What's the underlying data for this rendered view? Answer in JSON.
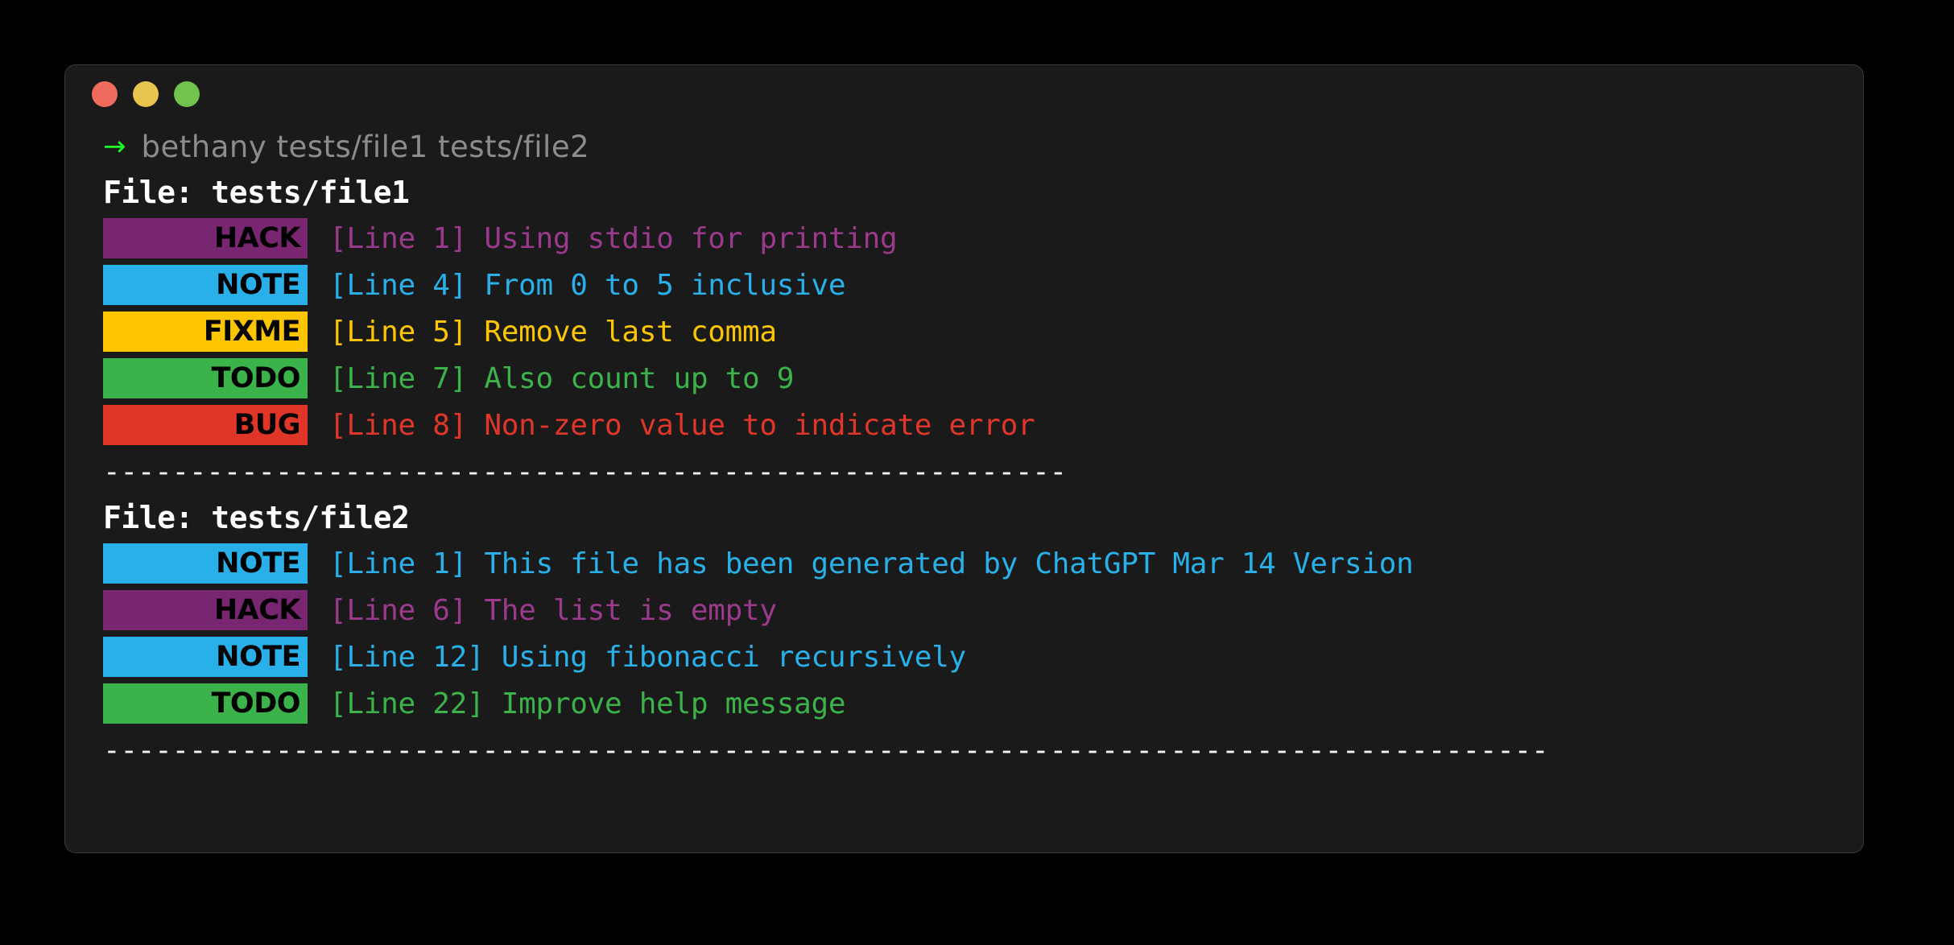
{
  "window": {
    "traffic_lights": [
      {
        "name": "close-button",
        "color": "#ef6b5e"
      },
      {
        "name": "minimize-button",
        "color": "#e7c44e"
      },
      {
        "name": "maximize-button",
        "color": "#72c250"
      }
    ]
  },
  "terminal": {
    "prompt_symbol": "→",
    "prompt_symbol_color": "#19f924",
    "command": "bethany tests/file1 tests/file2",
    "command_color": "#8c8c8c"
  },
  "tag_styles": {
    "HACK": {
      "badge_bg": "#78266f",
      "text_color": "#9b3a8c"
    },
    "NOTE": {
      "badge_bg": "#29b0e8",
      "text_color": "#29b0e8"
    },
    "FIXME": {
      "badge_bg": "#fdc500",
      "text_color": "#fdc500"
    },
    "TODO": {
      "badge_bg": "#3bb34a",
      "text_color": "#3bb34a"
    },
    "BUG": {
      "badge_bg": "#e0362a",
      "text_color": "#e0362a"
    }
  },
  "files": [
    {
      "heading": "File: tests/file1",
      "entries": [
        {
          "tag": "HACK",
          "message": "[Line 1] Using stdio for printing"
        },
        {
          "tag": "NOTE",
          "message": "[Line 4] From 0 to 5 inclusive"
        },
        {
          "tag": "FIXME",
          "message": "[Line 5] Remove last comma"
        },
        {
          "tag": "TODO",
          "message": "[Line 7] Also count up to 9"
        },
        {
          "tag": "BUG",
          "message": "[Line 8] Non-zero value to indicate error"
        }
      ],
      "separator": "--------------------------------------------------------"
    },
    {
      "heading": "File: tests/file2",
      "entries": [
        {
          "tag": "NOTE",
          "message": "[Line 1] This file has been generated by ChatGPT Mar 14 Version"
        },
        {
          "tag": "HACK",
          "message": "[Line 6] The list is empty"
        },
        {
          "tag": "NOTE",
          "message": "[Line 12] Using fibonacci recursively"
        },
        {
          "tag": "TODO",
          "message": "[Line 22] Improve help message"
        }
      ],
      "separator": "------------------------------------------------------------------------------------"
    }
  ]
}
